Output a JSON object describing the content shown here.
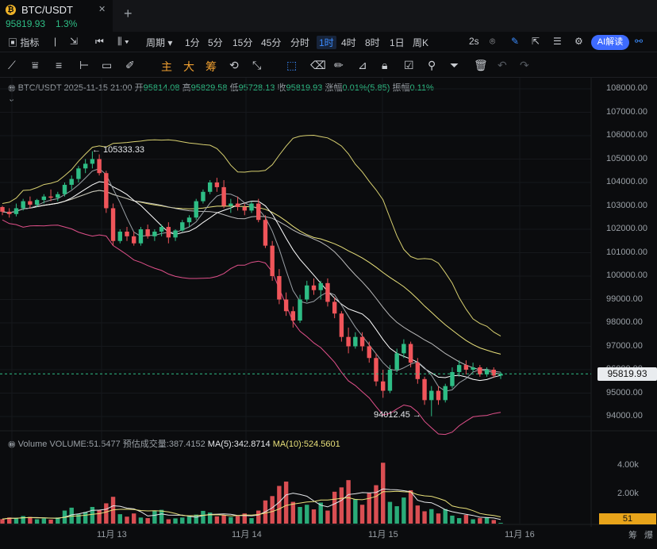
{
  "tab": {
    "coin_glyph": "₿",
    "symbol": "BTC/USDT",
    "close_icon": "close-icon",
    "price": "95819.93",
    "change": "1.3%"
  },
  "toolbar": {
    "indicators": "指标",
    "period": "周期",
    "intervals": [
      "1分",
      "5分",
      "15分",
      "45分",
      "分时",
      "1时",
      "4时",
      "8时",
      "1日",
      "周K"
    ],
    "active_interval": "1时",
    "refresh": "2s",
    "ai_label": "AI解读"
  },
  "drawing_tools": {
    "main": "主",
    "big": "大",
    "chip": "筹"
  },
  "ohlc": {
    "pair": "BTC/USDT",
    "datetime": "2025-11-15 21:00",
    "open_label": "开",
    "open": "95814.08",
    "high_label": "高",
    "high": "95829.58",
    "low_label": "低",
    "low": "95728.13",
    "close_label": "收",
    "close": "95819.93",
    "chg_label": "涨幅",
    "chg": "0.01%(5.85)",
    "amp_label": "振幅",
    "amp": "0.11%"
  },
  "volume_info": {
    "title": "Volume",
    "volume": "VOLUME:51.5477",
    "est": "预估成交量:387.4152",
    "ma5": "MA(5):342.8714",
    "ma10": "MA(10):524.5601"
  },
  "price_axis": [
    "108000.00",
    "107000.00",
    "106000.00",
    "105000.00",
    "104000.00",
    "103000.00",
    "102000.00",
    "101000.00",
    "100000.00",
    "99000.00",
    "98000.00",
    "97000.00",
    "96000.00",
    "95000.00",
    "94000.00"
  ],
  "volume_axis": [
    "4.00k",
    "2.00k"
  ],
  "current_price_tag": "95819.93",
  "current_volume_tag": "51",
  "annotations": {
    "high": "← 105333.33",
    "low": "94012.45 →"
  },
  "time_axis": [
    "11月 13",
    "11月 14",
    "11月 15",
    "11月 16"
  ],
  "footer": {
    "chip": "筹",
    "burst": "爆"
  },
  "colors": {
    "up": "#2ebd85",
    "down": "#f0555a",
    "ma_yellow": "#e8e07a",
    "boll": "#d8d070",
    "lower": "#e0508a",
    "white": "#e6e8eb"
  },
  "chart_data": {
    "type": "candlestick",
    "interval": "1h",
    "ylim": [
      93600,
      108500
    ],
    "high_marker": 105333.33,
    "low_marker": 94012.45,
    "last_price": 95819.93,
    "candles": [
      [
        102950,
        103000,
        102600,
        102750
      ],
      [
        102750,
        102900,
        102500,
        102650
      ],
      [
        102650,
        103100,
        102550,
        102900
      ],
      [
        102900,
        103300,
        102800,
        103200
      ],
      [
        103200,
        103400,
        102900,
        103050
      ],
      [
        103050,
        103300,
        102950,
        103250
      ],
      [
        103250,
        103500,
        103100,
        103400
      ],
      [
        103400,
        103700,
        103200,
        103350
      ],
      [
        103350,
        103600,
        103200,
        103500
      ],
      [
        103500,
        104000,
        103400,
        103900
      ],
      [
        103900,
        104300,
        103700,
        104150
      ],
      [
        104150,
        104700,
        104000,
        104600
      ],
      [
        104600,
        105000,
        104400,
        104800
      ],
      [
        104800,
        105333,
        104600,
        105000
      ],
      [
        105000,
        105200,
        104300,
        104400
      ],
      [
        104400,
        104500,
        102700,
        102900
      ],
      [
        102900,
        103100,
        101300,
        101500
      ],
      [
        101500,
        102000,
        101400,
        101900
      ],
      [
        101900,
        102100,
        101500,
        101700
      ],
      [
        101700,
        101900,
        101300,
        101400
      ],
      [
        101400,
        102100,
        101300,
        102000
      ],
      [
        102000,
        102200,
        101600,
        101700
      ],
      [
        101700,
        102000,
        101500,
        101900
      ],
      [
        101900,
        102200,
        101700,
        102100
      ],
      [
        102100,
        102300,
        101400,
        101650
      ],
      [
        101650,
        102000,
        101500,
        101950
      ],
      [
        101950,
        102400,
        101900,
        102300
      ],
      [
        102300,
        102600,
        102100,
        102500
      ],
      [
        102500,
        103300,
        102400,
        103200
      ],
      [
        103200,
        103700,
        103100,
        103600
      ],
      [
        103600,
        104100,
        103500,
        104000
      ],
      [
        104000,
        104200,
        103600,
        103800
      ],
      [
        103800,
        104100,
        102900,
        103000
      ],
      [
        103000,
        103300,
        102700,
        103100
      ],
      [
        103100,
        103400,
        102800,
        102950
      ],
      [
        102950,
        103100,
        102600,
        102800
      ],
      [
        102800,
        103200,
        102700,
        103100
      ],
      [
        103100,
        103300,
        102300,
        102400
      ],
      [
        102400,
        102600,
        101200,
        101300
      ],
      [
        101300,
        101500,
        99800,
        100000
      ],
      [
        100000,
        100300,
        98800,
        99000
      ],
      [
        99000,
        99300,
        98300,
        98500
      ],
      [
        98500,
        98700,
        97800,
        98100
      ],
      [
        98100,
        99200,
        98000,
        99000
      ],
      [
        99000,
        99800,
        98900,
        99600
      ],
      [
        99600,
        99900,
        99200,
        99400
      ],
      [
        99400,
        99800,
        99000,
        99700
      ],
      [
        99700,
        99900,
        98700,
        98900
      ],
      [
        98900,
        99100,
        98200,
        98400
      ],
      [
        98400,
        98500,
        97200,
        97400
      ],
      [
        97400,
        97800,
        96700,
        97000
      ],
      [
        97000,
        97600,
        96900,
        97400
      ],
      [
        97400,
        97600,
        96800,
        97000
      ],
      [
        97000,
        97200,
        96300,
        96500
      ],
      [
        96500,
        96700,
        95300,
        95500
      ],
      [
        95500,
        96000,
        94800,
        95100
      ],
      [
        95100,
        96200,
        95000,
        96000
      ],
      [
        96000,
        96900,
        95900,
        96700
      ],
      [
        96700,
        97300,
        96500,
        97100
      ],
      [
        97100,
        97200,
        96100,
        96300
      ],
      [
        96300,
        96500,
        95400,
        95600
      ],
      [
        95600,
        95700,
        94500,
        94700
      ],
      [
        94700,
        95300,
        94012,
        95100
      ],
      [
        95100,
        95300,
        94500,
        94700
      ],
      [
        94700,
        95400,
        94600,
        95300
      ],
      [
        95300,
        96100,
        95200,
        95900
      ],
      [
        95900,
        96400,
        95700,
        96200
      ],
      [
        96200,
        96400,
        95800,
        96000
      ],
      [
        96000,
        96300,
        95900,
        96100
      ],
      [
        96100,
        96200,
        95700,
        95800
      ],
      [
        95800,
        96100,
        95700,
        96000
      ],
      [
        96000,
        96100,
        95650,
        95750
      ],
      [
        95750,
        95900,
        95600,
        95820
      ]
    ],
    "volume_ylim": [
      0,
      5200
    ],
    "volumes": [
      310,
      420,
      380,
      520,
      460,
      300,
      350,
      280,
      420,
      900,
      1100,
      650,
      800,
      1150,
      950,
      1400,
      1850,
      650,
      480,
      700,
      420,
      380,
      900,
      950,
      300,
      360,
      420,
      500,
      620,
      880,
      760,
      500,
      600,
      450,
      520,
      700,
      380,
      900,
      1600,
      1900,
      2600,
      2900,
      1500,
      1150,
      1300,
      980,
      1450,
      900,
      2200,
      2500,
      3000,
      1700,
      1300,
      2100,
      2650,
      4200,
      1500,
      1200,
      1800,
      2300,
      1250,
      850,
      1000,
      700,
      1000,
      550,
      380,
      600,
      300,
      380,
      420,
      250,
      52
    ]
  }
}
